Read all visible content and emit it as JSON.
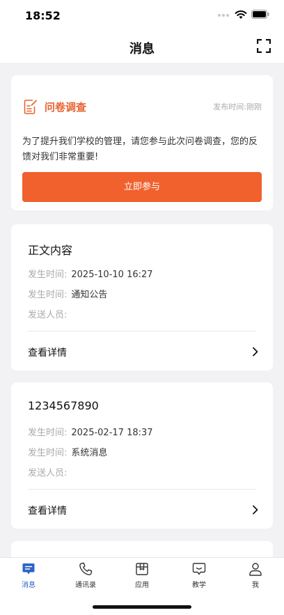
{
  "status_bar": {
    "time": "18:52"
  },
  "nav": {
    "title": "消息",
    "scan_icon": "scan-icon"
  },
  "survey": {
    "title": "问卷调查",
    "time_label": "发布时间:",
    "time_value": "刚刚",
    "description": "为了提升我们学校的管理，请您参与此次问卷调查，您的反馈对我们非常重要!",
    "button_label": "立即参与",
    "accent_color": "#f0612d"
  },
  "messages": [
    {
      "title": "正文内容",
      "time_label": "发生时间:",
      "time_value": "2025-10-10 16:27",
      "type_label": "发生时间:",
      "type_value": "通知公告",
      "sender_label": "发送人员:",
      "sender_value": "",
      "detail_label": "查看详情"
    },
    {
      "title": "1234567890",
      "time_label": "发生时间:",
      "time_value": "2025-02-17 18:37",
      "type_label": "发生时间:",
      "type_value": "系统消息",
      "sender_label": "发送人员:",
      "sender_value": "",
      "detail_label": "查看详情"
    }
  ],
  "tabs": [
    {
      "label": "消息",
      "icon": "message-icon",
      "active": true
    },
    {
      "label": "通讯录",
      "icon": "phone-icon",
      "active": false
    },
    {
      "label": "应用",
      "icon": "app-box-icon",
      "active": false
    },
    {
      "label": "教学",
      "icon": "teaching-icon",
      "active": false
    },
    {
      "label": "我",
      "icon": "person-icon",
      "active": false
    }
  ],
  "colors": {
    "tab_active": "#2b63c8",
    "background": "#f2f2f4"
  }
}
